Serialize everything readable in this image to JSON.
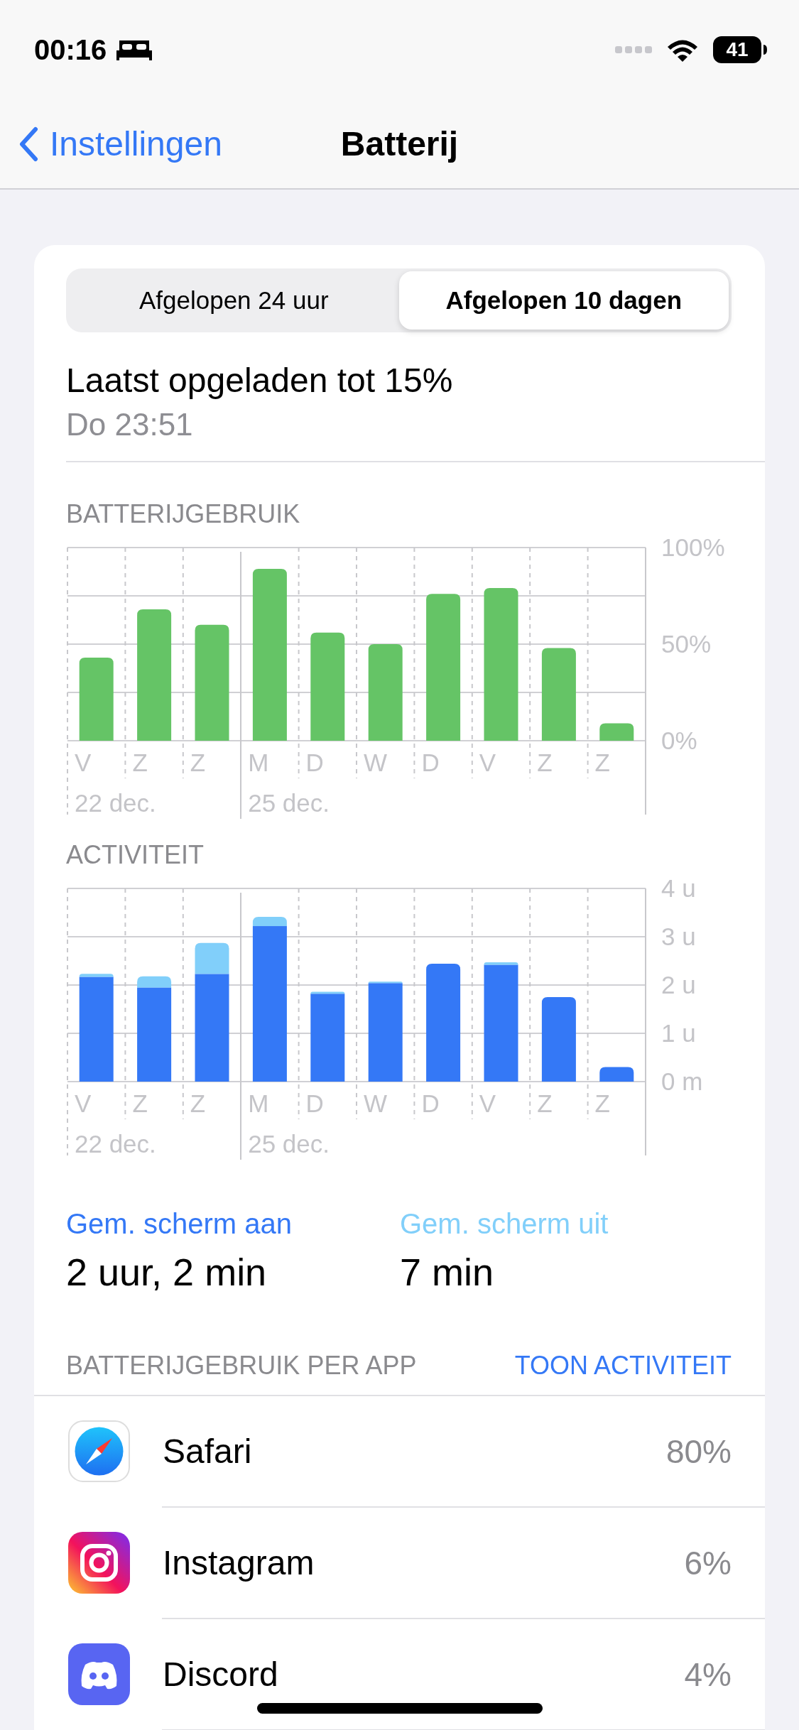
{
  "status_bar": {
    "time": "00:16",
    "battery": "41"
  },
  "nav": {
    "back": "Instellingen",
    "title": "Batterij"
  },
  "segments": [
    {
      "label": "Afgelopen 24 uur",
      "selected": false
    },
    {
      "label": "Afgelopen 10 dagen",
      "selected": true
    }
  ],
  "last_charged": {
    "title": "Laatst opgeladen tot 15%",
    "time": "Do 23:51"
  },
  "battery_usage": {
    "header": "BATTERIJGEBRUIK",
    "chart_data": {
      "type": "bar",
      "categories": [
        "V",
        "Z",
        "Z",
        "M",
        "D",
        "W",
        "D",
        "V",
        "Z",
        "Z"
      ],
      "series": [
        {
          "color": "#65c466",
          "values": [
            43,
            68,
            60,
            89,
            56,
            50,
            76,
            79,
            48,
            9
          ]
        }
      ],
      "ylim": [
        0,
        100
      ],
      "yticks": [
        {
          "value": 0,
          "label": "0%"
        },
        {
          "value": 50,
          "label": "50%"
        },
        {
          "value": 100,
          "label": "100%"
        }
      ],
      "grid": true
    },
    "dates": [
      "22 dec.",
      "25 dec."
    ]
  },
  "activity": {
    "header": "ACTIVITEIT",
    "chart_data": {
      "type": "bar",
      "stacked": true,
      "categories": [
        "V",
        "Z",
        "Z",
        "M",
        "D",
        "W",
        "D",
        "V",
        "Z",
        "Z"
      ],
      "series": [
        {
          "color": "#3478f6",
          "values": [
            2.17,
            1.95,
            2.23,
            3.22,
            1.82,
            2.04,
            2.44,
            2.42,
            1.75,
            0.3
          ]
        },
        {
          "color": "#81cffa",
          "values": [
            0.06,
            0.23,
            0.64,
            0.19,
            0.04,
            0.03,
            null,
            0.05,
            0,
            0
          ]
        }
      ],
      "ylim": [
        0,
        4
      ],
      "yticks": [
        {
          "value": 0,
          "label": "0 m"
        },
        {
          "value": 1,
          "label": "1 u"
        },
        {
          "value": 2,
          "label": "2 u"
        },
        {
          "value": 3,
          "label": "3 u"
        },
        {
          "value": 4,
          "label": "4 u"
        }
      ],
      "grid": true
    },
    "dates": [
      "22 dec.",
      "25 dec."
    ]
  },
  "averages": [
    {
      "label": "Gem. scherm aan",
      "value": "2 uur, 2 min",
      "color": "#3478f6"
    },
    {
      "label": "Gem. scherm uit",
      "value": "7 min",
      "color": "#81cffa"
    }
  ],
  "apps_section": {
    "header": "BATTERIJGEBRUIK PER APP",
    "action": "TOON ACTIVITEIT"
  },
  "apps": [
    {
      "name": "Safari",
      "percent": "80%",
      "kind": "compass"
    },
    {
      "name": "Instagram",
      "percent": "6%",
      "kind": "camera"
    },
    {
      "name": "Discord",
      "percent": "4%",
      "kind": "gamepad"
    }
  ]
}
